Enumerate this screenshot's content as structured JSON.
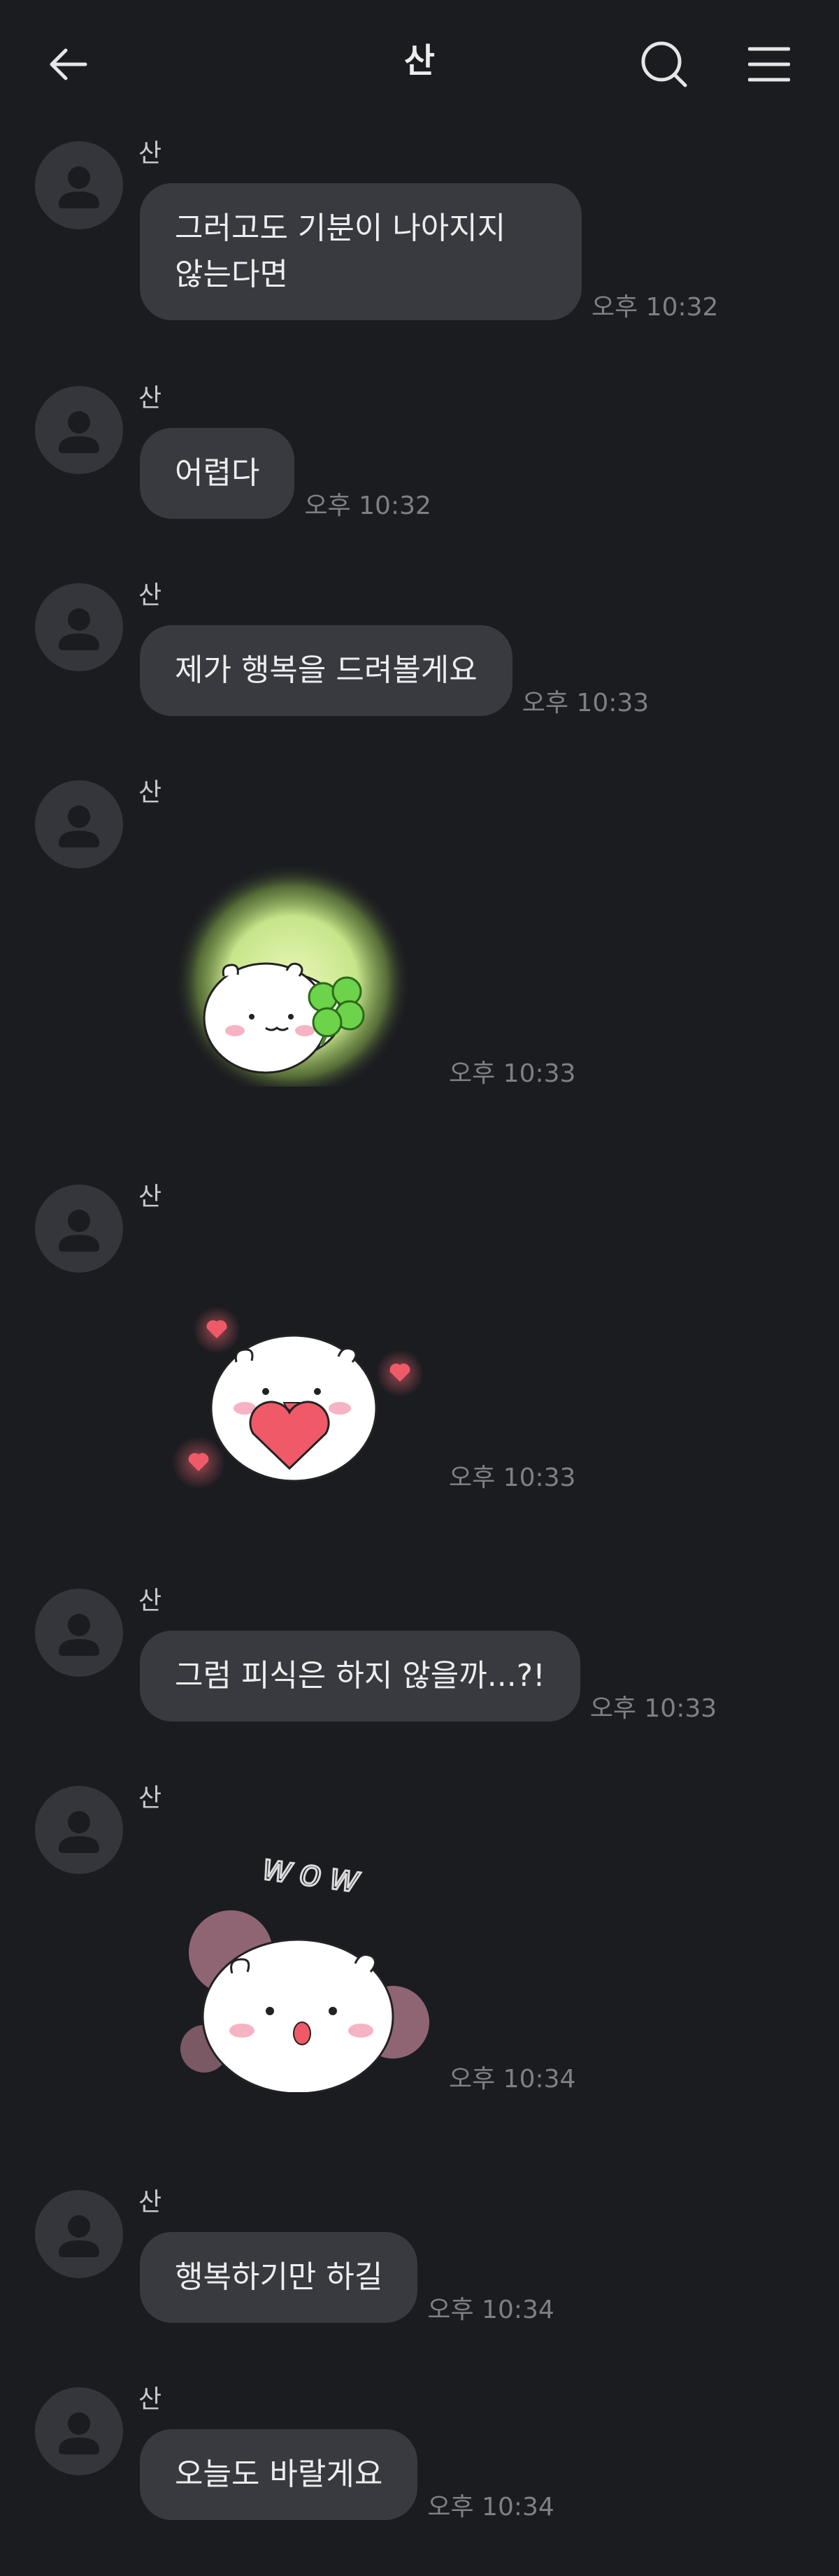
{
  "header": {
    "title": "산",
    "back_icon": "back-arrow-icon",
    "search_icon": "search-icon",
    "menu_icon": "hamburger-menu-icon"
  },
  "messages": [
    {
      "sender": "산",
      "type": "text",
      "text": "그러고도 기분이 나아지지\n않는다면",
      "time": "오후 10:32"
    },
    {
      "sender": "산",
      "type": "text",
      "text": "어렵다",
      "time": "오후 10:32"
    },
    {
      "sender": "산",
      "type": "text",
      "text": "제가 행복을 드려볼게요",
      "time": "오후 10:33"
    },
    {
      "sender": "산",
      "type": "sticker",
      "sticker": "hamster-clover-sticker",
      "time": "오후 10:33"
    },
    {
      "sender": "산",
      "type": "sticker",
      "sticker": "hamster-heart-sticker",
      "time": "오후 10:33"
    },
    {
      "sender": "산",
      "type": "text",
      "text": "그럼 피식은 하지 않을까...?!",
      "time": "오후 10:33"
    },
    {
      "sender": "산",
      "type": "sticker",
      "sticker": "hamster-wow-sticker",
      "sticker_text": "wow",
      "time": "오후 10:34"
    },
    {
      "sender": "산",
      "type": "text",
      "text": "행복하기만 하길",
      "time": "오후 10:34"
    },
    {
      "sender": "산",
      "type": "text",
      "text": "오늘도 바랄게요",
      "time": "오후 10:34"
    }
  ],
  "colors": {
    "background": "#1b1c20",
    "bubble": "#383a40",
    "avatar": "#35363b",
    "time_text": "#7f8086"
  }
}
